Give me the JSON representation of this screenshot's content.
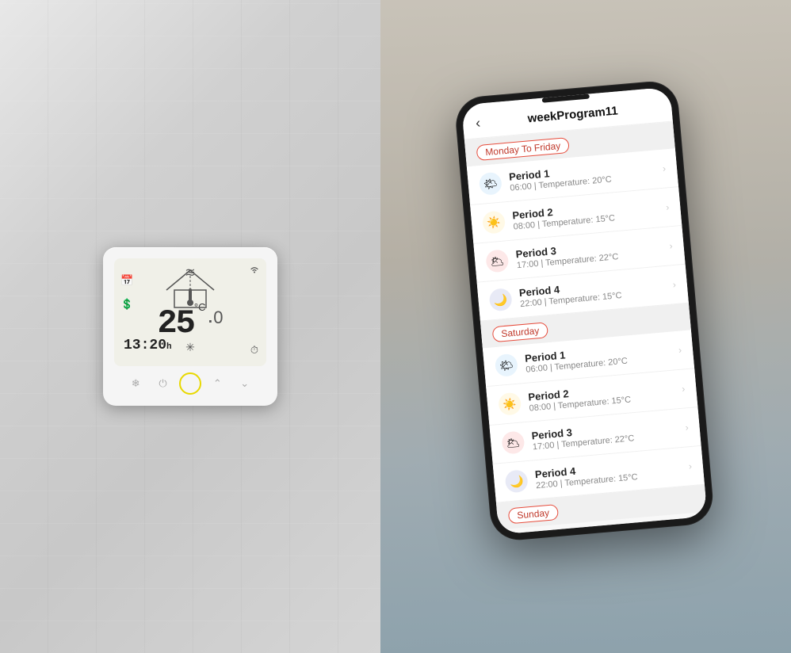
{
  "app": {
    "title": "weekProgram11",
    "back_label": "‹"
  },
  "thermostat": {
    "temperature": "25",
    "temp_unit": "°C",
    "time": "13:20",
    "time_suffix": "h"
  },
  "sections": [
    {
      "id": "monday-friday",
      "label": "Monday To Friday",
      "periods": [
        {
          "id": 1,
          "name": "Period 1",
          "detail": "06:00  |  Temperature: 20°C",
          "icon_type": "morning",
          "icon": "🌤"
        },
        {
          "id": 2,
          "name": "Period 2",
          "detail": "08:00  |  Temperature: 15°C",
          "icon_type": "day",
          "icon": "☀️"
        },
        {
          "id": 3,
          "name": "Period 3",
          "detail": "17:00  |  Temperature: 22°C",
          "icon_type": "evening",
          "icon": "🌥"
        },
        {
          "id": 4,
          "name": "Period 4",
          "detail": "22:00  |  Temperature: 15°C",
          "icon_type": "night",
          "icon": "🌙"
        }
      ]
    },
    {
      "id": "saturday",
      "label": "Saturday",
      "periods": [
        {
          "id": 1,
          "name": "Period 1",
          "detail": "06:00  |  Temperature: 20°C",
          "icon_type": "morning",
          "icon": "🌤"
        },
        {
          "id": 2,
          "name": "Period 2",
          "detail": "08:00  |  Temperature: 15°C",
          "icon_type": "day",
          "icon": "☀️"
        },
        {
          "id": 3,
          "name": "Period 3",
          "detail": "17:00  |  Temperature: 22°C",
          "icon_type": "evening",
          "icon": "🌥"
        },
        {
          "id": 4,
          "name": "Period 4",
          "detail": "22:00  |  Temperature: 15°C",
          "icon_type": "night",
          "icon": "🌙"
        }
      ]
    },
    {
      "id": "sunday",
      "label": "Sunday",
      "periods": []
    }
  ],
  "colors": {
    "accent_red": "#c0392b",
    "border_red": "#e74c3c"
  }
}
